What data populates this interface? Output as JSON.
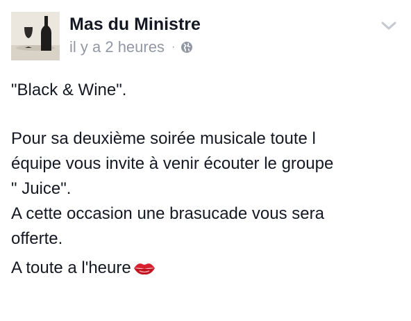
{
  "post": {
    "author": "Mas du Ministre",
    "timestamp": "il y a 2 heures",
    "separator": "·",
    "privacy_icon": "globe-icon",
    "menu_icon": "chevron-down-icon",
    "avatar_icon": "wine-bottle-and-glass",
    "text": {
      "line1": "\"Black & Wine\".",
      "paragraph2": "Pour sa deuxième soirée musicale toute l\néquipe vous invite à venir écouter le groupe\n\" Juice\".\nA cette occasion une brasucade vous sera\nofferte.",
      "closing": "A toute a l'heure",
      "closing_emoji": "kiss-lips-icon"
    }
  },
  "colors": {
    "author": "#141823",
    "meta": "#9197a3",
    "body_text": "#141823",
    "lips": "#d8212f"
  }
}
